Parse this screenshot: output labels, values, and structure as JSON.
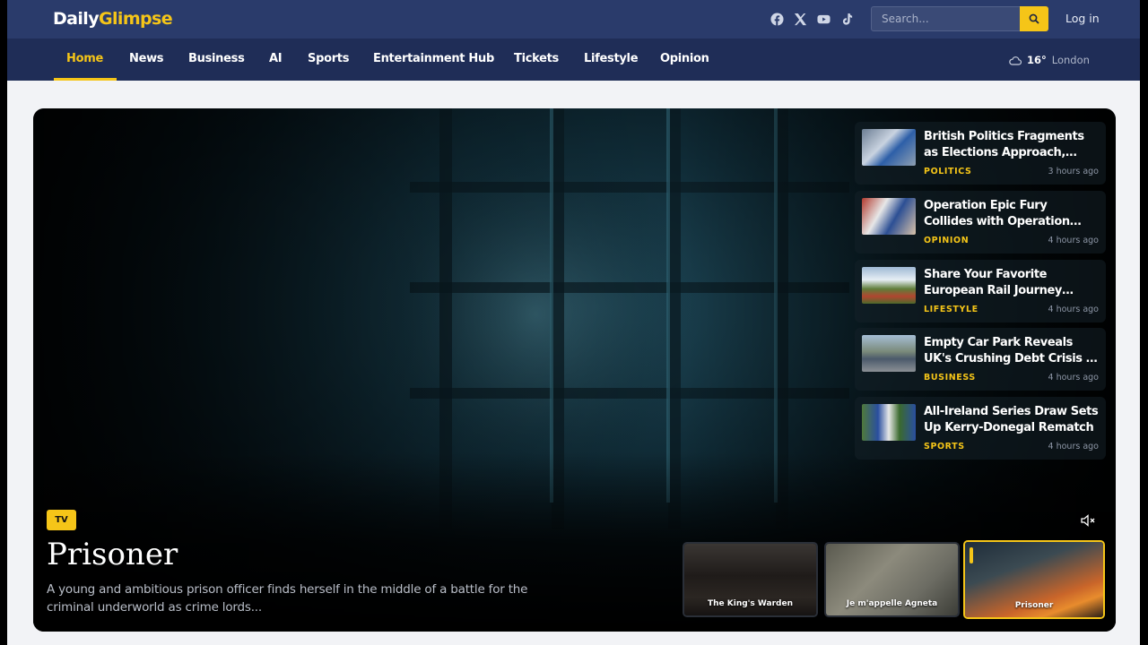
{
  "brand": {
    "part1": "Daily",
    "part2": "Glimpse"
  },
  "header": {
    "socials": [
      "facebook-icon",
      "x-icon",
      "youtube-icon",
      "tiktok-icon"
    ],
    "search_placeholder": "Search...",
    "login_label": "Log in"
  },
  "nav": {
    "items": [
      {
        "label": "Home",
        "active": true
      },
      {
        "label": "News"
      },
      {
        "label": "Business"
      },
      {
        "label": "AI"
      },
      {
        "label": "Sports"
      },
      {
        "label": "Entertainment Hub"
      },
      {
        "label": "Tickets"
      },
      {
        "label": "Lifestyle"
      },
      {
        "label": "Opinion"
      }
    ],
    "weather": {
      "icon": "cloud-icon",
      "temp": "16°",
      "city": "London"
    }
  },
  "hero": {
    "badge": "TV",
    "title": "Prisoner",
    "description": "A young and ambitious prison officer finds herself in the middle of a battle for the criminal underworld as crime lords..."
  },
  "sidebar": {
    "items": [
      {
        "title": "British Politics Fragments as Elections Approach, Shifting...",
        "category": "POLITICS",
        "time": "3 hours ago"
      },
      {
        "title": "Operation Epic Fury Collides with Operation Colossal...",
        "category": "OPINION",
        "time": "4 hours ago"
      },
      {
        "title": "Share Your Favorite European Rail Journey with...",
        "category": "LIFESTYLE",
        "time": "4 hours ago"
      },
      {
        "title": "Empty Car Park Reveals UK's Crushing Debt Crisis in One...",
        "category": "BUSINESS",
        "time": "4 hours ago"
      },
      {
        "title": "All-Ireland Series Draw Sets Up Kerry-Donegal Rematch",
        "category": "SPORTS",
        "time": "4 hours ago"
      }
    ]
  },
  "carousel": {
    "items": [
      {
        "label": "The King's Warden"
      },
      {
        "label": "Je m'appelle Agneta"
      },
      {
        "label": "Prisoner",
        "active": true
      }
    ]
  },
  "colors": {
    "accent": "#f5c518",
    "topbar": "#2a3b6b",
    "navbar": "#1f2d57"
  }
}
